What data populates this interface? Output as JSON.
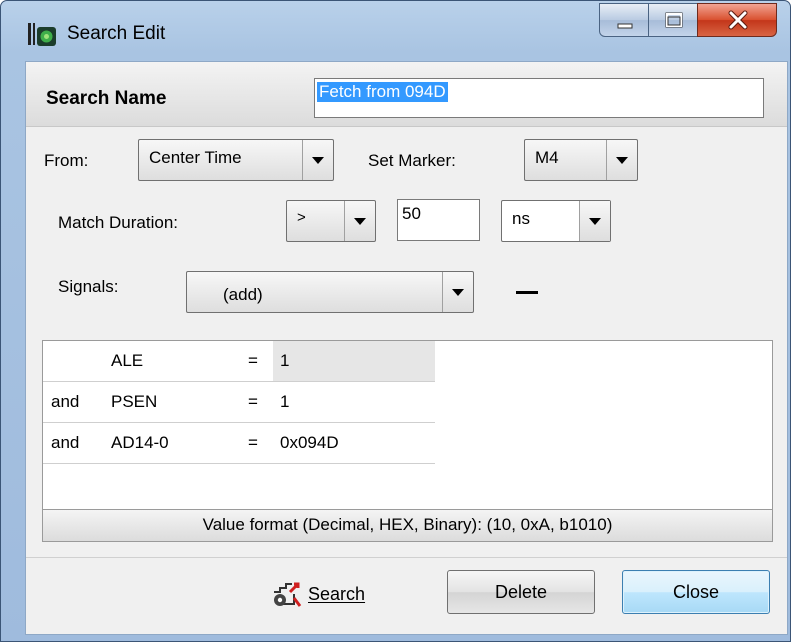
{
  "window": {
    "title": "Search Edit"
  },
  "search_name": {
    "label": "Search Name",
    "value": "Fetch from 094D"
  },
  "from": {
    "label": "From:",
    "value": "Center Time"
  },
  "set_marker": {
    "label": "Set Marker:",
    "value": "M4"
  },
  "match_duration": {
    "label": "Match Duration:",
    "operator": ">",
    "amount": "50",
    "unit": "ns"
  },
  "signals": {
    "label": "Signals:",
    "value": "(add)",
    "remove_label": "—"
  },
  "conditions": [
    {
      "conj": "",
      "signal": "ALE",
      "eq": "=",
      "value": "1"
    },
    {
      "conj": "and",
      "signal": "PSEN",
      "eq": "=",
      "value": "1"
    },
    {
      "conj": "and",
      "signal": "AD14-0",
      "eq": "=",
      "value": "0x094D"
    }
  ],
  "value_format_note": "Value format (Decimal, HEX, Binary):  (10, 0xA, b1010)",
  "buttons": {
    "search": "Search",
    "delete": "Delete",
    "close": "Close"
  }
}
